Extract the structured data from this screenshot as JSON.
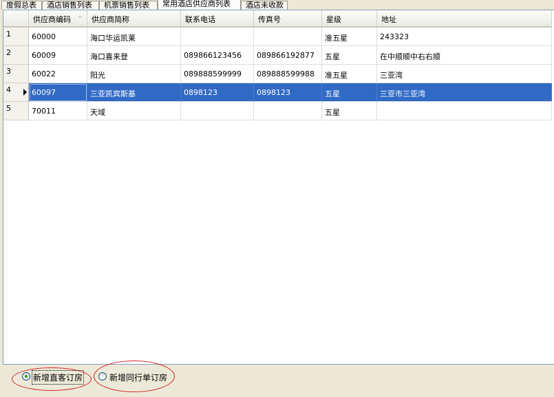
{
  "tabs": [
    {
      "label": "度假总表",
      "active": false
    },
    {
      "label": "酒店销售列表",
      "active": false
    },
    {
      "label": "机票销售列表",
      "active": false
    },
    {
      "label": "常用酒店供应商列表",
      "active": true
    },
    {
      "label": "酒店未收款",
      "active": false
    }
  ],
  "grid": {
    "columns": [
      "供应商编码",
      "供应商简称",
      "联系电话",
      "传真号",
      "星级",
      "地址"
    ],
    "sort_indicator": "^",
    "rows": [
      {
        "num": "1",
        "code": "60000",
        "name": "海口华运凯莱",
        "phone": "",
        "fax": "",
        "star": "准五星",
        "address": "243323",
        "selected": false
      },
      {
        "num": "2",
        "code": "60009",
        "name": "海口喜来登",
        "phone": "089866123456",
        "fax": "089866192877",
        "star": "五星",
        "address": "在中顺顺中右右顺",
        "selected": false
      },
      {
        "num": "3",
        "code": "60022",
        "name": "阳光",
        "phone": "089888599999",
        "fax": "089888599988",
        "star": "准五星",
        "address": "三亚湾",
        "selected": false
      },
      {
        "num": "4",
        "code": "60097",
        "name": "三亚凯宾斯基",
        "phone": "0898123",
        "fax": "0898123",
        "star": "五星",
        "address": "三亚市三亚湾",
        "selected": true
      },
      {
        "num": "5",
        "code": "70011",
        "name": "天域",
        "phone": "",
        "fax": "",
        "star": "五星",
        "address": "",
        "selected": false
      }
    ]
  },
  "options": {
    "direct_label": "新增直客订房",
    "direct_checked": true,
    "peer_label": "新增同行单订房",
    "peer_checked": false
  },
  "colors": {
    "selection": "#316ac5",
    "annotation": "#d62020"
  }
}
